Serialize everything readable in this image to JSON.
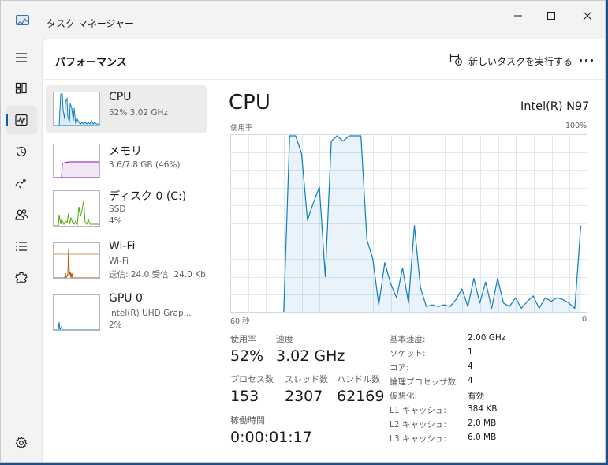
{
  "window": {
    "title": "タスク マネージャー"
  },
  "nav": {
    "items": [
      {
        "name": "menu-icon",
        "active": false
      },
      {
        "name": "processes-icon",
        "active": false
      },
      {
        "name": "performance-icon",
        "active": true
      },
      {
        "name": "app-history-icon",
        "active": false
      },
      {
        "name": "startup-apps-icon",
        "active": false
      },
      {
        "name": "users-icon",
        "active": false
      },
      {
        "name": "details-icon",
        "active": false
      },
      {
        "name": "services-icon",
        "active": false
      }
    ],
    "settings_icon": "settings-icon"
  },
  "header": {
    "title": "パフォーマンス",
    "run_task_label": "新しいタスクを実行する",
    "more_icon": "more-icon"
  },
  "resources": [
    {
      "name": "CPU",
      "line1": "52%  3.02 GHz",
      "line2": "",
      "color": "#117dbb"
    },
    {
      "name": "メモリ",
      "line1": "3.6/7.8 GB (46%)",
      "line2": "",
      "color": "#8b12ae"
    },
    {
      "name": "ディスク 0 (C:)",
      "line1": "SSD",
      "line2": "4%",
      "color": "#4da60c"
    },
    {
      "name": "Wi-Fi",
      "line1": "Wi-Fi",
      "line2": "送信: 24.0  受信: 24.0 Kb",
      "color": "#a74f01"
    },
    {
      "name": "GPU 0",
      "line1": "Intel(R) UHD Grap...",
      "line2": "2%",
      "color": "#117dbb"
    }
  ],
  "detail": {
    "title": "CPU",
    "model": "Intel(R) N97",
    "graph_label": "使用率",
    "graph_max": "100%",
    "graph_time": "60 秒",
    "graph_min": "0",
    "graph_color": "#117dbb",
    "stats": {
      "usage_label": "使用率",
      "usage": "52%",
      "speed_label": "速度",
      "speed": "3.02 GHz",
      "processes_label": "プロセス数",
      "processes": "153",
      "threads_label": "スレッド数",
      "threads": "2307",
      "handles_label": "ハンドル数",
      "handles": "62169",
      "uptime_label": "稼働時間",
      "uptime": "0:00:01:17"
    },
    "specs": [
      {
        "label": "基本速度:",
        "value": "2.00 GHz"
      },
      {
        "label": "ソケット:",
        "value": "1"
      },
      {
        "label": "コア:",
        "value": "4"
      },
      {
        "label": "論理プロセッサ数:",
        "value": "4"
      },
      {
        "label": "仮想化:",
        "value": "有効"
      },
      {
        "label": "L1 キャッシュ:",
        "value": "384 KB"
      },
      {
        "label": "L2 キャッシュ:",
        "value": "2.0 MB"
      },
      {
        "label": "L3 キャッシュ:",
        "value": "6.0 MB"
      }
    ]
  },
  "chart_data": {
    "type": "area",
    "x": [
      60,
      59,
      58,
      57,
      56,
      55,
      54,
      53,
      52,
      51,
      50,
      49,
      48,
      47,
      46,
      45,
      44,
      43,
      42,
      41,
      40,
      39,
      38,
      37,
      36,
      35,
      34,
      33,
      32,
      31,
      30,
      29,
      28,
      27,
      26,
      25,
      24,
      23,
      22,
      21,
      20,
      19,
      18,
      17,
      16,
      15,
      14,
      13,
      12,
      11,
      10,
      9,
      8,
      7,
      6,
      5,
      4,
      3,
      2,
      1,
      0
    ],
    "series": [
      {
        "values": [
          null,
          null,
          null,
          null,
          null,
          null,
          null,
          null,
          null,
          0,
          100,
          100,
          90,
          52,
          62,
          71,
          20,
          97,
          100,
          97,
          100,
          100,
          100,
          41,
          30,
          4,
          28,
          16,
          8,
          25,
          5,
          49,
          14,
          3,
          4,
          3,
          4,
          3,
          7,
          13,
          3,
          19,
          5,
          17,
          2,
          19,
          5,
          3,
          8,
          2,
          6,
          9,
          2,
          8,
          6,
          8,
          7,
          5,
          2,
          49
        ]
      }
    ],
    "xlabel": "60 秒",
    "ylabel": "使用率",
    "ylim": [
      0,
      100
    ],
    "grid": true
  }
}
